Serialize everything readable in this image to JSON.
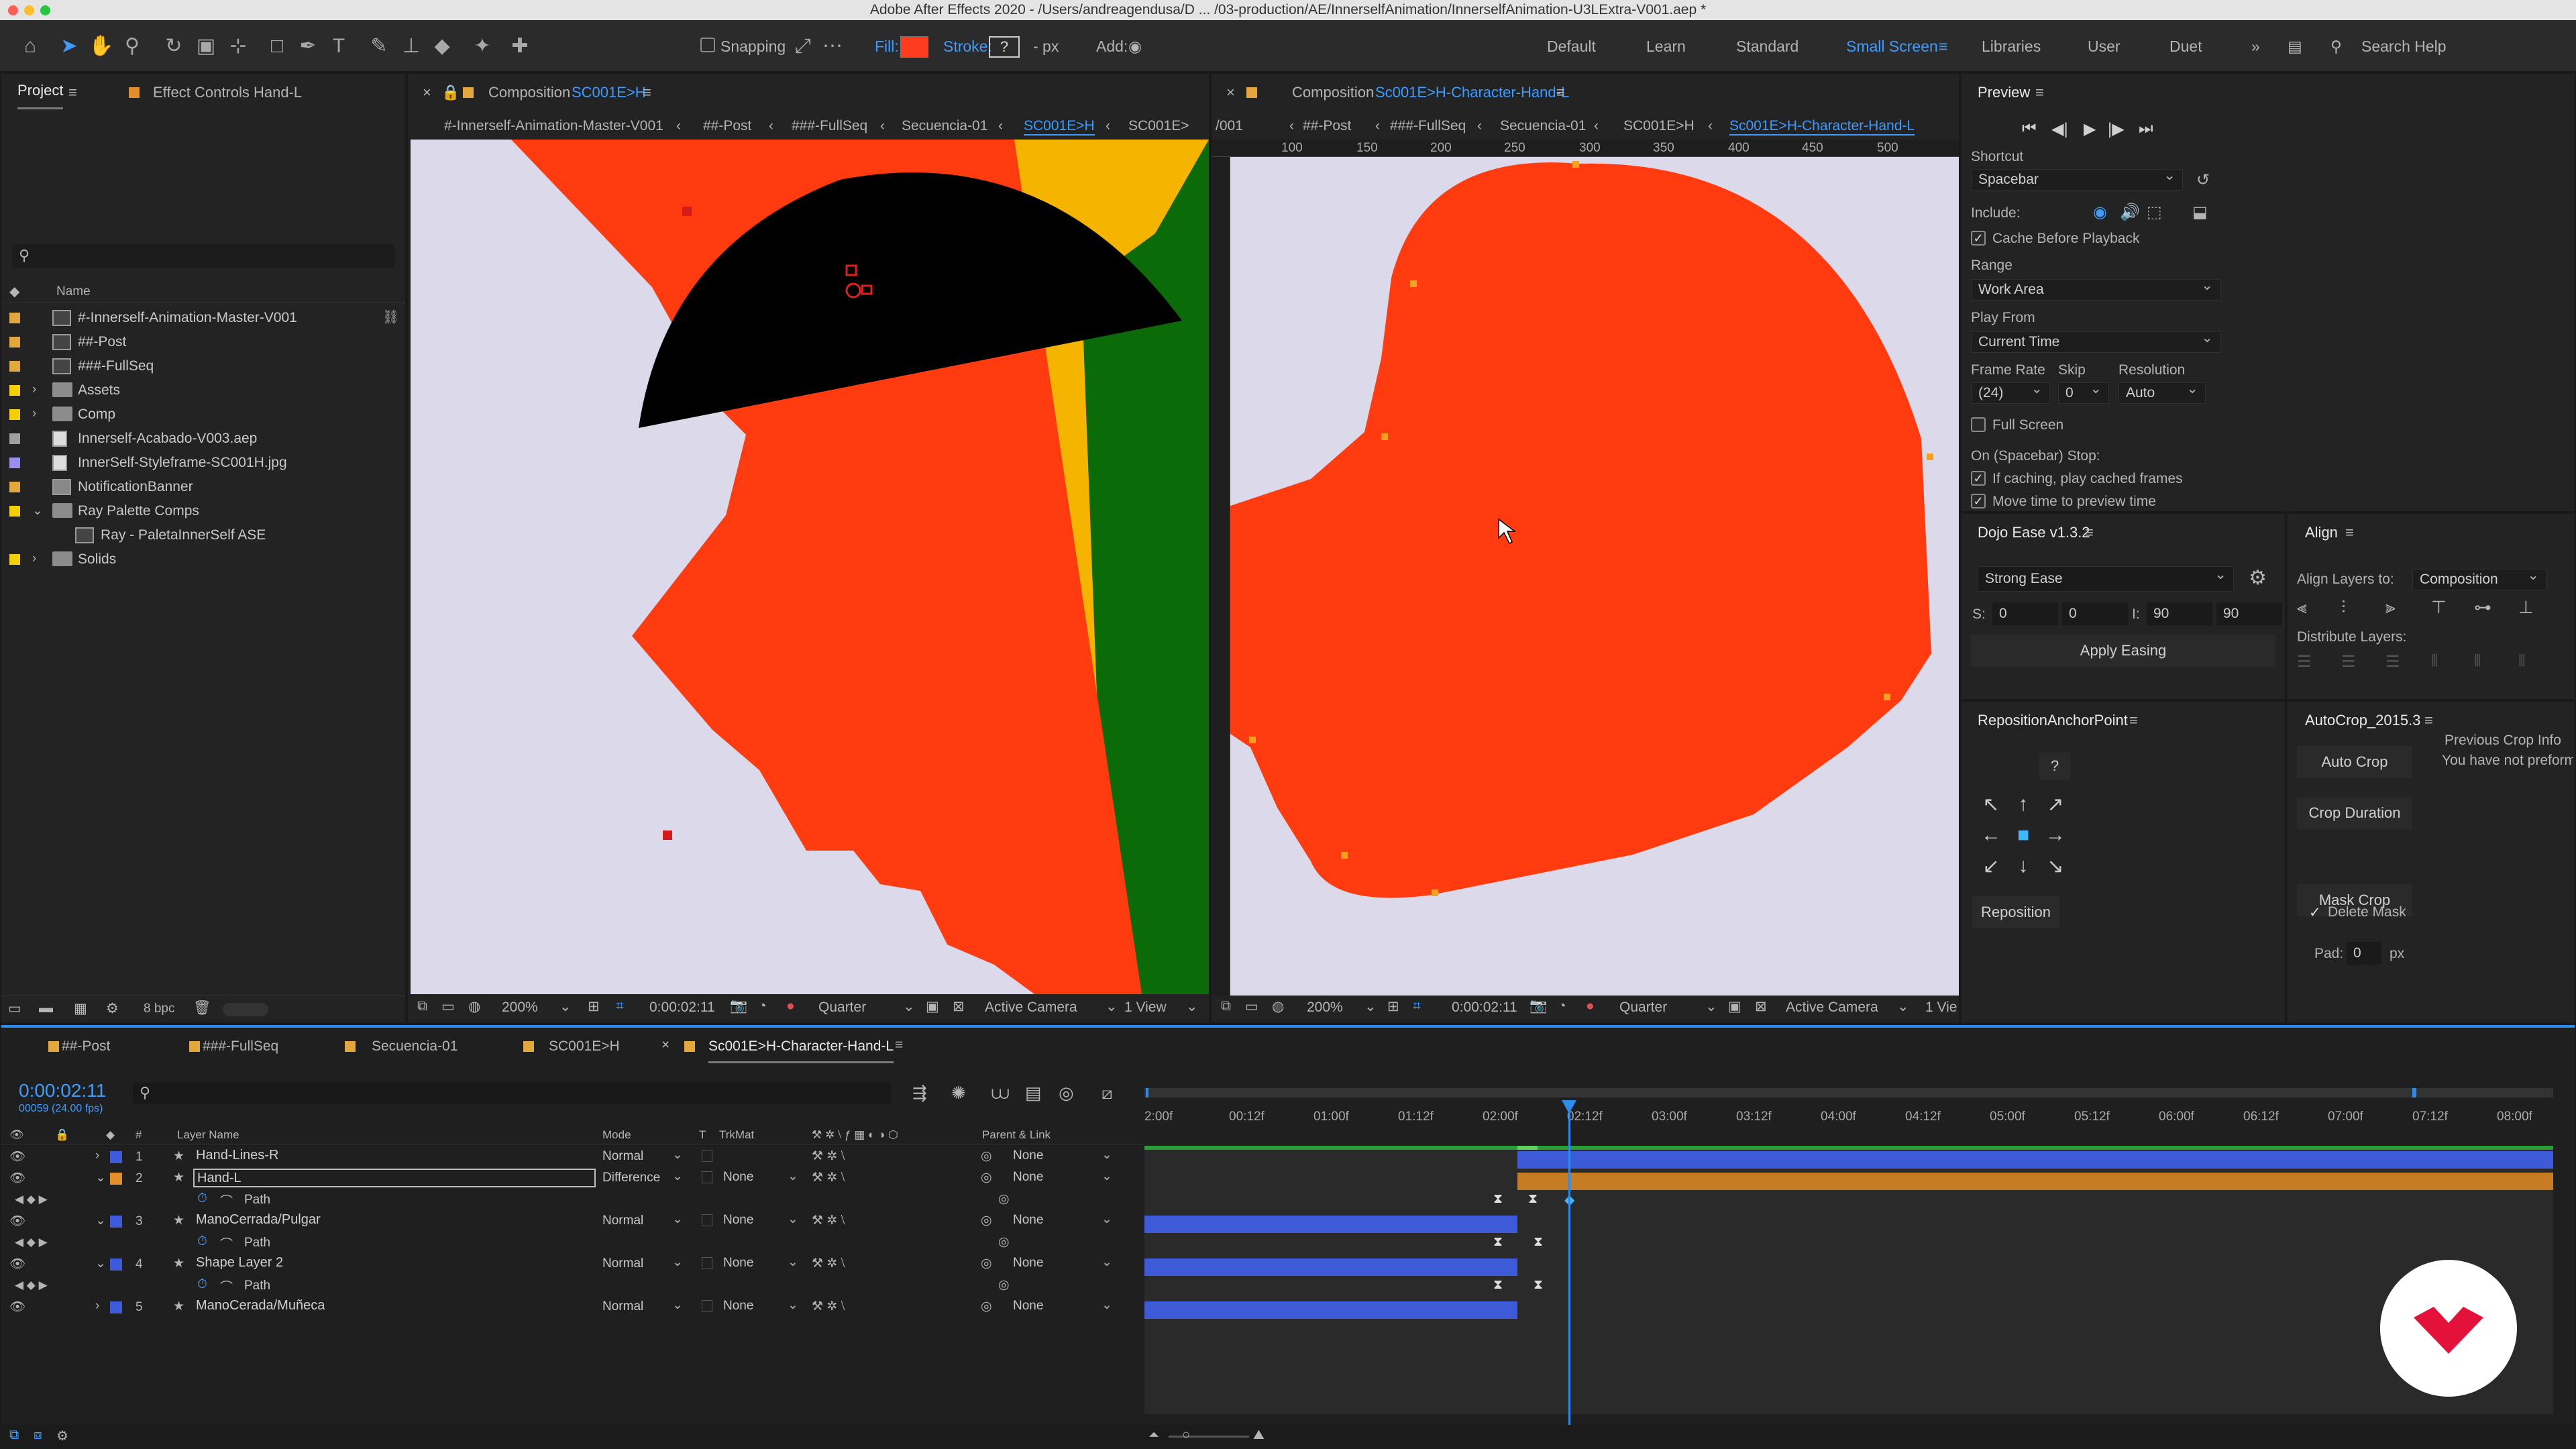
{
  "window": {
    "title": "Adobe After Effects 2020 - /Users/andreagendusa/D ... /03-production/AE/InnerselfAnimation/InnerselfAnimation-U3LExtra-V001.aep *"
  },
  "toolbar": {
    "snapping": "Snapping",
    "fill_label": "Fill:",
    "fill_color": "#ff3b1e",
    "stroke_label": "Stroke:",
    "stroke_value": "?",
    "stroke_px": "- px",
    "add_label": "Add:",
    "workspaces": [
      "Default",
      "Learn",
      "Standard",
      "Small Screen",
      "Libraries",
      "User",
      "Duet"
    ],
    "active_workspace": "Small Screen",
    "search_placeholder": "Search Help"
  },
  "project": {
    "tab_project": "Project",
    "tab_effect_controls": "Effect Controls Hand-L",
    "col_name": "Name",
    "bpc": "8 bpc",
    "items": [
      {
        "name": "#-Innerself-Animation-Master-V001",
        "kind": "comp",
        "swatch": "#e2a73d"
      },
      {
        "name": "##-Post",
        "kind": "comp",
        "swatch": "#e2a73d"
      },
      {
        "name": "###-FullSeq",
        "kind": "comp",
        "swatch": "#e2a73d"
      },
      {
        "name": "Assets",
        "kind": "folder",
        "swatch": "#f5d000"
      },
      {
        "name": "Comp",
        "kind": "folder",
        "swatch": "#f5d000"
      },
      {
        "name": "Innerself-Acabado-V003.aep",
        "kind": "file",
        "swatch": "#a0a0a0"
      },
      {
        "name": "InnerSelf-Styleframe-SC001H.jpg",
        "kind": "file",
        "swatch": "#9a8ff0"
      },
      {
        "name": "NotificationBanner",
        "kind": "solid",
        "swatch": "#e2a73d"
      },
      {
        "name": "Ray Palette Comps",
        "kind": "folder-open",
        "swatch": "#f5d000"
      },
      {
        "name": "Ray - PaletaInnerSelf ASE",
        "kind": "comp",
        "swatch": ""
      },
      {
        "name": "Solids",
        "kind": "folder",
        "swatch": "#f5d000"
      }
    ]
  },
  "viewer1": {
    "tab_prefix": "Composition",
    "tab_comp": "SC001E>H",
    "breadcrumbs": [
      "#-Innerself-Animation-Master-V001",
      "##-Post",
      "###-FullSeq",
      "Secuencia-01",
      "SC001E>H",
      "SC001E>"
    ],
    "active_crumb": "SC001E>H",
    "zoom": "200%",
    "time": "0:00:02:11",
    "resolution": "Quarter",
    "camera": "Active Camera",
    "views": "1 View"
  },
  "viewer2": {
    "tab_prefix": "Composition",
    "tab_comp": "Sc001E>H-Character-Hand-L",
    "breadcrumbs": [
      "/001",
      "##-Post",
      "###-FullSeq",
      "Secuencia-01",
      "SC001E>H",
      "Sc001E>H-Character-Hand-L"
    ],
    "active_crumb": "Sc001E>H-Character-Hand-L",
    "ruler": [
      "100",
      "150",
      "200",
      "250",
      "300",
      "350",
      "400",
      "450",
      "500"
    ],
    "zoom": "200%",
    "time": "0:00:02:11",
    "resolution": "Quarter",
    "camera": "Active Camera",
    "views": "1 Vie"
  },
  "preview": {
    "title": "Preview",
    "shortcut_label": "Shortcut",
    "shortcut_value": "Spacebar",
    "include_label": "Include:",
    "cache_before": "Cache Before Playback",
    "range_label": "Range",
    "range_value": "Work Area",
    "play_from_label": "Play From",
    "play_from_value": "Current Time",
    "frame_rate_label": "Frame Rate",
    "skip_label": "Skip",
    "resolution_label": "Resolution",
    "frame_rate_value": "(24)",
    "skip_value": "0",
    "resolution_value": "Auto",
    "full_screen": "Full Screen",
    "stop_label": "On (Spacebar) Stop:",
    "if_caching": "If caching, play cached frames",
    "move_time": "Move time to preview time"
  },
  "dojo": {
    "title": "Dojo Ease v1.3.2",
    "preset": "Strong Ease",
    "s_label": "S:",
    "s_in": "0",
    "s_out": "0",
    "i_label": "I:",
    "i_in": "90",
    "i_out": "90",
    "apply": "Apply Easing"
  },
  "align": {
    "title": "Align",
    "align_to_label": "Align Layers to:",
    "align_to_value": "Composition",
    "distribute_label": "Distribute Layers:"
  },
  "reposition": {
    "title": "RepositionAnchorPoint",
    "help": "?",
    "button": "Reposition"
  },
  "autocrop": {
    "title": "AutoCrop_2015.3",
    "auto_crop": "Auto Crop",
    "crop_duration": "Crop Duration",
    "mask_crop": "Mask Crop",
    "delete_mask": "Delete Mask",
    "delete_mask_check": "✓",
    "pad_label": "Pad:",
    "pad_value": "0",
    "pad_unit": "px",
    "prev_info_title": "Previous Crop Info",
    "prev_info_text": "You have not preform"
  },
  "timeline": {
    "tabs": [
      "##-Post",
      "###-FullSeq",
      "Secuencia-01",
      "SC001E>H",
      "Sc001E>H-Character-Hand-L"
    ],
    "active_tab": "Sc001E>H-Character-Hand-L",
    "timecode": "0:00:02:11",
    "frames": "00059 (24.00 fps)",
    "col_hash": "#",
    "col_layer": "Layer Name",
    "col_mode": "Mode",
    "col_t": "T",
    "col_trkmat": "TrkMat",
    "col_parent": "Parent & Link",
    "ruler": [
      "2:00f",
      "00:12f",
      "01:00f",
      "01:12f",
      "02:00f",
      "02:12f",
      "03:00f",
      "03:12f",
      "04:00f",
      "04:12f",
      "05:00f",
      "05:12f",
      "06:00f",
      "06:12f",
      "07:00f",
      "07:12f",
      "08:00f"
    ],
    "layers": [
      {
        "num": "1",
        "name": "Hand-Lines-R",
        "label": "#3d5bd9",
        "mode": "Normal",
        "trkmat": "",
        "parent": "None",
        "bar": "blue"
      },
      {
        "num": "2",
        "name": "Hand-L",
        "label": "#e38e2c",
        "mode": "Difference",
        "trkmat": "None",
        "parent": "None",
        "bar": "orange"
      },
      {
        "path": "Path"
      },
      {
        "num": "3",
        "name": "ManoCerrada/Pulgar",
        "label": "#3d5bd9",
        "mode": "Normal",
        "trkmat": "None",
        "parent": "None",
        "bar": "blue"
      },
      {
        "path": "Path"
      },
      {
        "num": "4",
        "name": "Shape Layer 2",
        "label": "#3d5bd9",
        "mode": "Normal",
        "trkmat": "None",
        "parent": "None",
        "bar": "blue"
      },
      {
        "path": "Path"
      },
      {
        "num": "5",
        "name": "ManoCerada/Muñeca",
        "label": "#3d5bd9",
        "mode": "Normal",
        "trkmat": "None",
        "parent": "None",
        "bar": "blue"
      }
    ]
  },
  "colors": {
    "accent": "#2d8ceb",
    "orange_red": "#ff3b0f",
    "bg_canvas": "#dcd9ea",
    "green": "#0b6b08",
    "yellow": "#f4b400"
  }
}
